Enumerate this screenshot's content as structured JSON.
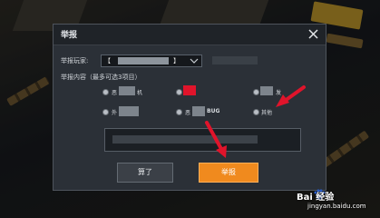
{
  "dialog": {
    "title": "举报",
    "close_icon": "close-icon",
    "player_label": "举报玩家:",
    "player_value": "【",
    "player_suffix": "】",
    "content_label": "举报内容（最多可选3项目）",
    "options": [
      {
        "label": "恶",
        "label2": "机"
      },
      {
        "label": "",
        "label2": ""
      },
      {
        "label": "",
        "label2": "发"
      },
      {
        "label": "外",
        "label2": ""
      },
      {
        "label": "恶",
        "label2": "BUG"
      },
      {
        "label": "其他",
        "label2": ""
      }
    ],
    "cancel_label": "算了",
    "submit_label": "举报"
  },
  "watermark": {
    "logo": "Bai 经验",
    "url": "jingyan.baidu.com"
  },
  "colors": {
    "submit_button": "#f08a1e",
    "arrows": "#e0142b"
  }
}
